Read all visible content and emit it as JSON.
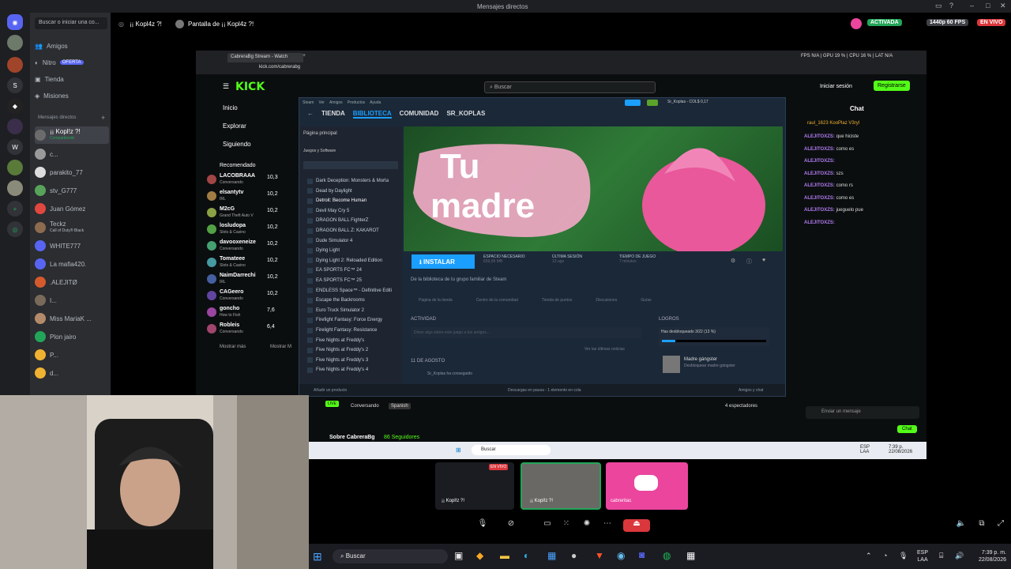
{
  "window": {
    "title": "Mensajes directos"
  },
  "discord": {
    "search_placeholder": "Buscar o iniciar una co...",
    "nav": [
      {
        "label": "Amigos"
      },
      {
        "label": "Nitro",
        "badge": "OFERTA"
      },
      {
        "label": "Tienda"
      },
      {
        "label": "Misiones"
      }
    ],
    "dm_header": "Mensajes directos",
    "dms": [
      "¡¡ Kopl!z ?!",
      "c...",
      "parakito_77",
      "stv_G777",
      "Juan Gómez",
      "Teckz",
      "WHITE777",
      "La mafia420.",
      ".ALEJITØ",
      "I...",
      "Miss MariaK ...",
      "Plon jairo",
      "P...",
      "d..."
    ],
    "dm_sub": {
      "first": "Compartiendo",
      "teckz": "Call of Duty® Black"
    },
    "call_header": {
      "user": "¡¡ Kopl4z ?!",
      "screen": "Pantalla de ¡¡ Kopl4z ?!",
      "status": "ACTIVADA",
      "quality": "1440p 60 FPS",
      "live": "EN VIVO"
    },
    "tiles": [
      {
        "label": "¡¡ Kopl!z ?!",
        "badge": "EN VIVO"
      },
      {
        "label": "¡¡ Kopl!z ?!"
      },
      {
        "label": "cabreritac"
      }
    ]
  },
  "overlay": {
    "fps": "FPS N/A",
    "gpu": "GPU 19 %",
    "cpu": "CPU 16 %",
    "lat": "LAT N/A"
  },
  "browser": {
    "tab": "CabreraBg Stream - Watch",
    "url": "kick.com/cabrerabg"
  },
  "kick": {
    "logo": "KICK",
    "search_placeholder": "Buscar",
    "login": "Iniciar sesión",
    "register": "Registrarse",
    "nav": [
      "Inicio",
      "Explorar",
      "Siguiendo"
    ],
    "recommended_title": "Recomendado",
    "recommended": [
      {
        "name": "LACOBRAAA",
        "sub": "Conversando",
        "count": "10,3"
      },
      {
        "name": "elsantytv",
        "sub": "IRL",
        "count": "10,2"
      },
      {
        "name": "M2cG",
        "sub": "Grand Theft Auto V",
        "count": "10,2"
      },
      {
        "name": "losludopa",
        "sub": "Slots & Casino",
        "count": "10,2"
      },
      {
        "name": "davooxeneize",
        "sub": "Conversando",
        "count": "10,2"
      },
      {
        "name": "Tomateee",
        "sub": "Slots & Casino",
        "count": "10,2"
      },
      {
        "name": "NaimDarrechi",
        "sub": "IRL",
        "count": "10,2"
      },
      {
        "name": "CAGeero",
        "sub": "Conversando",
        "count": "10,2"
      },
      {
        "name": "goncho",
        "sub": "How to Fish",
        "count": "7,6"
      },
      {
        "name": "Robleis",
        "sub": "Conversando",
        "count": "6,4"
      }
    ],
    "show_more": "Mostrar más",
    "show_more2": "Mostrar M",
    "chat_title": "Chat",
    "chat_top": [
      "raul_1623",
      "KooPlaz",
      "V3ryl"
    ],
    "chat": [
      {
        "user": "ALEJITOXZS:",
        "msg": "que hiciste"
      },
      {
        "user": "ALEJITOXZS:",
        "msg": "como es"
      },
      {
        "user": "ALEJITOXZS:",
        "msg": ""
      },
      {
        "user": "ALEJITOXZS:",
        "msg": "szs"
      },
      {
        "user": "ALEJITOXZS:",
        "msg": "como rs"
      },
      {
        "user": "ALEJITOXZS:",
        "msg": "como es"
      },
      {
        "user": "ALEJITOXZS:",
        "msg": "jueguelo pue"
      },
      {
        "user": "ALEJITOXZS:",
        "msg": ""
      }
    ],
    "send_placeholder": "Enviar un mensaje",
    "chat_button": "Chat",
    "stream_tag1": "Conversando",
    "stream_tag2": "Spanish",
    "viewers": "4 espectadores",
    "about": "Sobre CabreraBg",
    "followers": "86 Seguidores"
  },
  "steam": {
    "menu": [
      "Steam",
      "Ver",
      "Amigos",
      "Productos",
      "Ayuda"
    ],
    "user": "Sr_Koplas",
    "balance": "COL$ 0,17",
    "tabs": [
      "TIENDA",
      "BIBLIOTECA",
      "COMUNIDAD",
      "SR_KOPLAS"
    ],
    "home": "Página principal",
    "filter": "Juegos y Software",
    "games": [
      "Dark Deception: Monsters & Morta",
      "Dead by Daylight",
      "Detroit: Become Human",
      "Devil May Cry 5",
      "DRAGON BALL FighterZ",
      "DRAGON BALL Z: KAKAROT",
      "Dude Simulator 4",
      "Dying Light",
      "Dying Light 2: Reloaded Edition",
      "EA SPORTS FC™ 24",
      "EA SPORTS FC™ 25",
      "ENDLESS Space™ - Definitive Editi",
      "Escape the Backrooms",
      "Euro Truck Simulator 2",
      "Firefight Fantasy: Force Energy",
      "Firelight Fantasy: Resistance",
      "Five Nights at Freddy's",
      "Five Nights at Freddy's 2",
      "Five Nights at Freddy's 3",
      "Five Nights at Freddy's 4"
    ],
    "hero_text1": "Tu",
    "hero_text2": "madre",
    "install": "INSTALAR",
    "space_label": "ESPACIO NECESARIO",
    "space_value": "659,99 MB",
    "session_label": "ÚLTIMA SESIÓN",
    "session_value": "13 ago",
    "play_label": "TIEMPO DE JUEGO",
    "play_value": "7 minutos",
    "family": "De la biblioteca de tu grupo familiar de Steam",
    "subtabs": [
      "Página de la tienda",
      "Centro de la comunidad",
      "Tienda de puntos",
      "Discusiones",
      "Guías"
    ],
    "activity": "ACTIVIDAD",
    "activity_placeholder": "Dinos algo sobre este juego a tus amigos...",
    "news": "Ver las últimas noticias",
    "date": "11 DE AGOSTO",
    "feed": "Sr_Koplas ha conseguido",
    "achievements": "LOGROS",
    "unlocked": "Has desbloqueado 3/22 (13 %)",
    "ach_name": "Madre gángster",
    "ach_desc": "Desbloquear madre gángster",
    "add": "Añadir un producto",
    "downloads": "Descargas en pausa - 1 elemento en cola",
    "friends": "Amigos y chat"
  },
  "inner_taskbar": {
    "search": "Buscar",
    "lang": "ESP",
    "lang2": "LAA",
    "time": "7:39 p.",
    "date": "22/08/2026"
  },
  "taskbar": {
    "search": "Buscar",
    "lang": "ESP",
    "lang2": "LAA",
    "time": "7:39 p. m.",
    "date": "22/08/2026"
  }
}
